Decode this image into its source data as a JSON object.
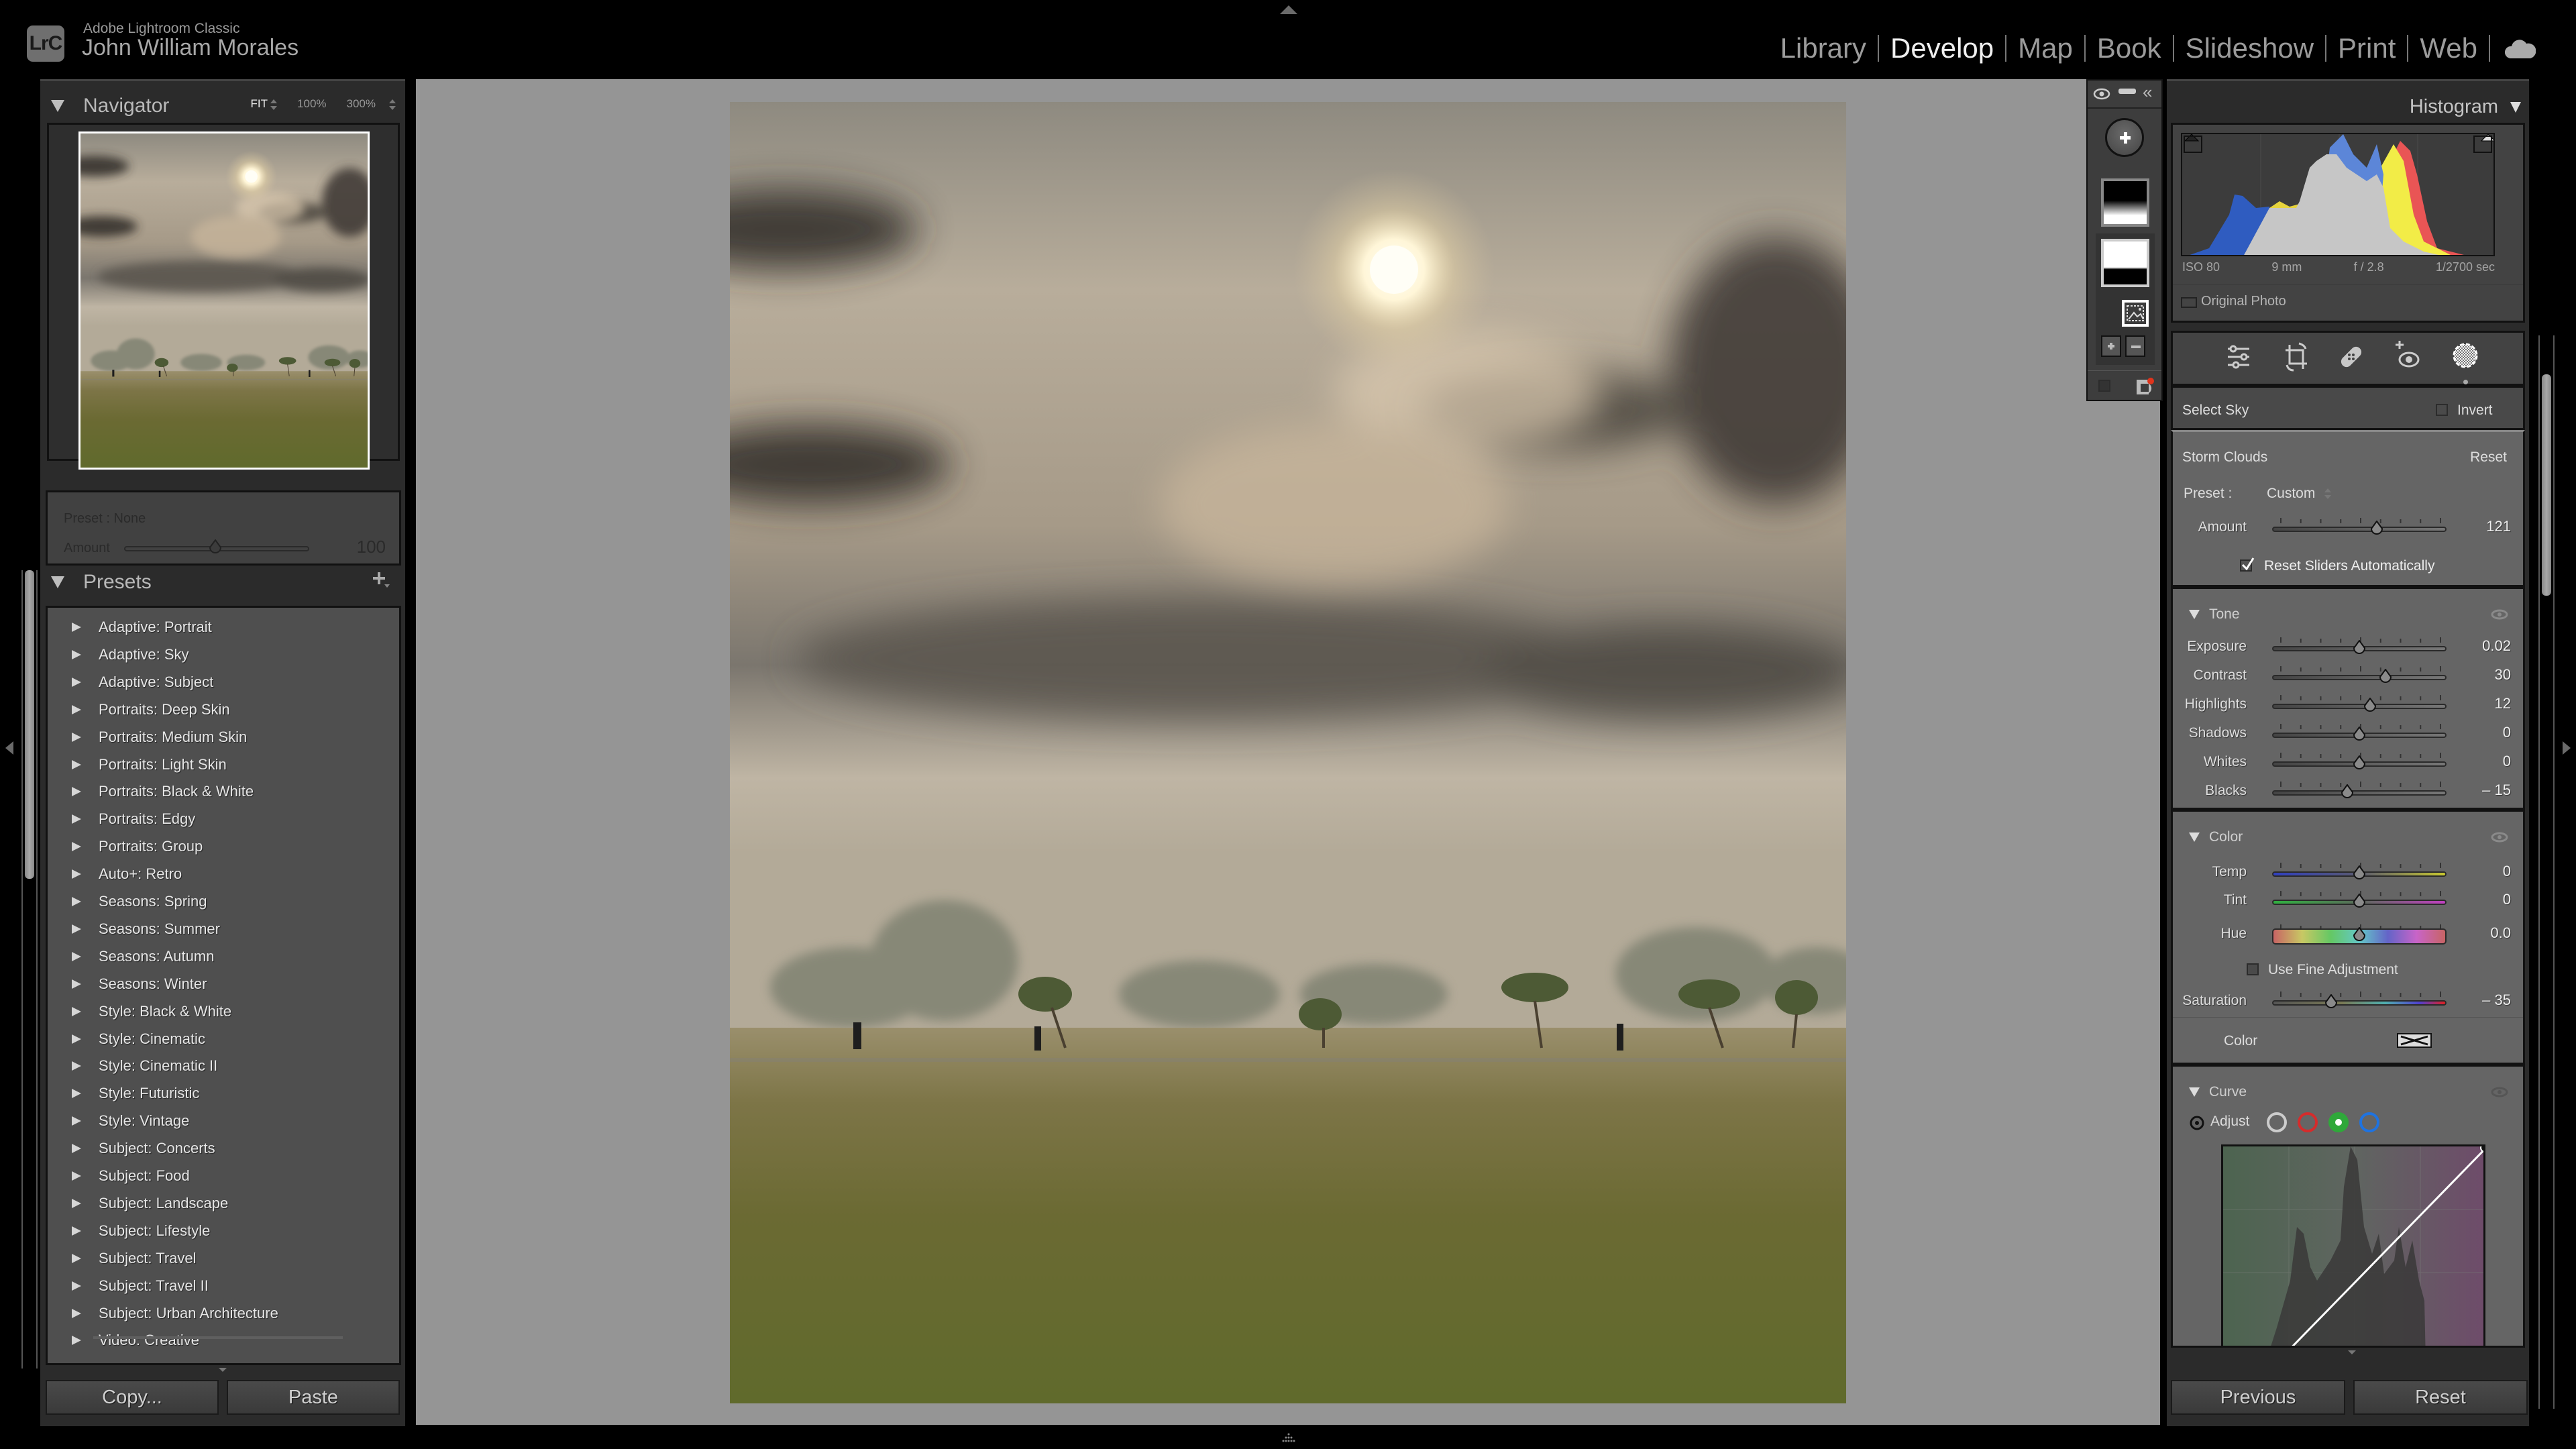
{
  "app": {
    "logo_text": "LrC",
    "product_name": "Adobe Lightroom Classic",
    "user_name": "John William Morales"
  },
  "modules": [
    {
      "label": "Library",
      "active": false
    },
    {
      "label": "Develop",
      "active": true
    },
    {
      "label": "Map",
      "active": false
    },
    {
      "label": "Book",
      "active": false
    },
    {
      "label": "Slideshow",
      "active": false
    },
    {
      "label": "Print",
      "active": false
    },
    {
      "label": "Web",
      "active": false
    }
  ],
  "navigator": {
    "title": "Navigator",
    "zoom_fit": "FIT",
    "zoom_100": "100%",
    "zoom_300": "300%"
  },
  "preset_amount": {
    "preset_label": "Preset : None",
    "amount_label": "Amount",
    "amount_value": "100"
  },
  "presets": {
    "title": "Presets",
    "items": [
      "Adaptive: Portrait",
      "Adaptive: Sky",
      "Adaptive: Subject",
      "Portraits: Deep Skin",
      "Portraits: Medium Skin",
      "Portraits: Light Skin",
      "Portraits: Black & White",
      "Portraits: Edgy",
      "Portraits: Group",
      "Auto+: Retro",
      "Seasons: Spring",
      "Seasons: Summer",
      "Seasons: Autumn",
      "Seasons: Winter",
      "Style: Black & White",
      "Style: Cinematic",
      "Style: Cinematic II",
      "Style: Futuristic",
      "Style: Vintage",
      "Subject: Concerts",
      "Subject: Food",
      "Subject: Landscape",
      "Subject: Lifestyle",
      "Subject: Travel",
      "Subject: Travel II",
      "Subject: Urban Architecture",
      "Video: Creative"
    ]
  },
  "left_buttons": {
    "copy": "Copy...",
    "paste": "Paste"
  },
  "histogram": {
    "title": "Histogram",
    "iso": "ISO 80",
    "focal": "9 mm",
    "aperture": "f / 2.8",
    "shutter": "1/2700 sec",
    "original_photo_label": "Original Photo",
    "original_photo_checked": false
  },
  "mask": {
    "select_label": "Select Sky",
    "invert_label": "Invert",
    "invert_checked": false,
    "effect_name": "Storm Clouds",
    "reset_label": "Reset",
    "preset_label": "Preset :",
    "preset_value": "Custom",
    "amount_label": "Amount",
    "amount_value": "121",
    "amount_fraction": 0.6,
    "reset_sliders_label": "Reset Sliders Automatically",
    "reset_sliders_checked": true
  },
  "tone": {
    "title": "Tone",
    "sliders": [
      {
        "label": "Exposure",
        "value": "0.02",
        "pos": 0.5
      },
      {
        "label": "Contrast",
        "value": "30",
        "pos": 0.65
      },
      {
        "label": "Highlights",
        "value": "12",
        "pos": 0.56
      },
      {
        "label": "Shadows",
        "value": "0",
        "pos": 0.5
      },
      {
        "label": "Whites",
        "value": "0",
        "pos": 0.5
      },
      {
        "label": "Blacks",
        "value": "– 15",
        "pos": 0.43
      }
    ]
  },
  "color": {
    "title": "Color",
    "temp": {
      "label": "Temp",
      "value": "0",
      "pos": 0.5
    },
    "tint": {
      "label": "Tint",
      "value": "0",
      "pos": 0.5
    },
    "hue": {
      "label": "Hue",
      "value": "0.0",
      "pos": 0.5
    },
    "fine_adjust_label": "Use Fine Adjustment",
    "fine_adjust_checked": false,
    "saturation": {
      "label": "Saturation",
      "value": "– 35",
      "pos": 0.34
    },
    "swatch_label": "Color"
  },
  "curve": {
    "title": "Curve",
    "adjust_label": "Adjust",
    "channels": [
      "all",
      "red",
      "green",
      "blue"
    ],
    "active_channel": "green"
  },
  "right_buttons": {
    "previous": "Previous",
    "reset": "Reset"
  }
}
